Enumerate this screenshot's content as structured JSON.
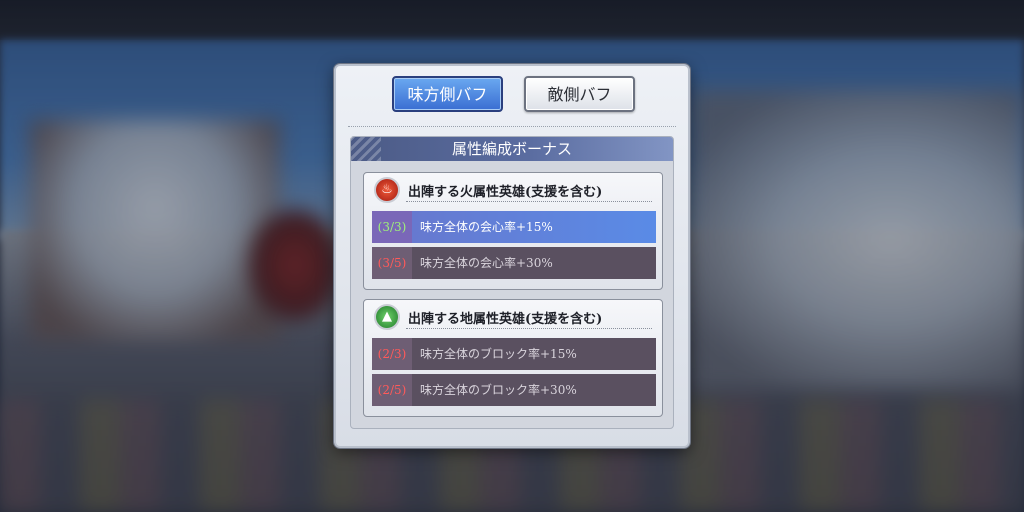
{
  "tabs": {
    "ally_label": "味方側バフ",
    "enemy_label": "敵側バフ"
  },
  "panel": {
    "title": "属性編成ボーナス"
  },
  "groups": [
    {
      "icon": "fire-icon",
      "title": "出陣する火属性英雄(支援を含む)",
      "rows": [
        {
          "count": "(3/3)",
          "text": "味方全体の会心率+15%",
          "active": true
        },
        {
          "count": "(3/5)",
          "text": "味方全体の会心率+30%",
          "active": false
        }
      ]
    },
    {
      "icon": "earth-icon",
      "title": "出陣する地属性英雄(支援を含む)",
      "rows": [
        {
          "count": "(2/3)",
          "text": "味方全体のブロック率+15%",
          "active": false
        },
        {
          "count": "(2/5)",
          "text": "味方全体のブロック率+30%",
          "active": false
        }
      ]
    }
  ],
  "colors": {
    "active_tab": "#3a6ed2",
    "active_row": "#5a8be6",
    "met_count": "#9ff07a",
    "unmet_count": "#ff5a5a"
  }
}
